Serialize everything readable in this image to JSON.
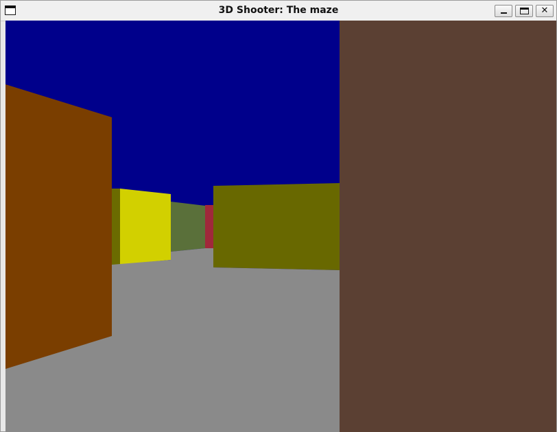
{
  "window": {
    "title": "3D Shooter: The maze",
    "controls": {
      "minimize_icon": "minimize-icon",
      "maximize_icon": "maximize-icon",
      "close_icon": "close-icon",
      "close_glyph": "✕"
    }
  },
  "scene": {
    "colors": {
      "sky": "#00008b",
      "floor": "#8a8a8a",
      "wall_left_near": "#7a3e00",
      "wall_olive_side": "#6b6b00",
      "wall_yellow": "#d2d000",
      "wall_green": "#5a703a",
      "wall_red": "#a0283a",
      "wall_olive_right": "#686800",
      "wall_brown_right": "#5b4033"
    }
  }
}
